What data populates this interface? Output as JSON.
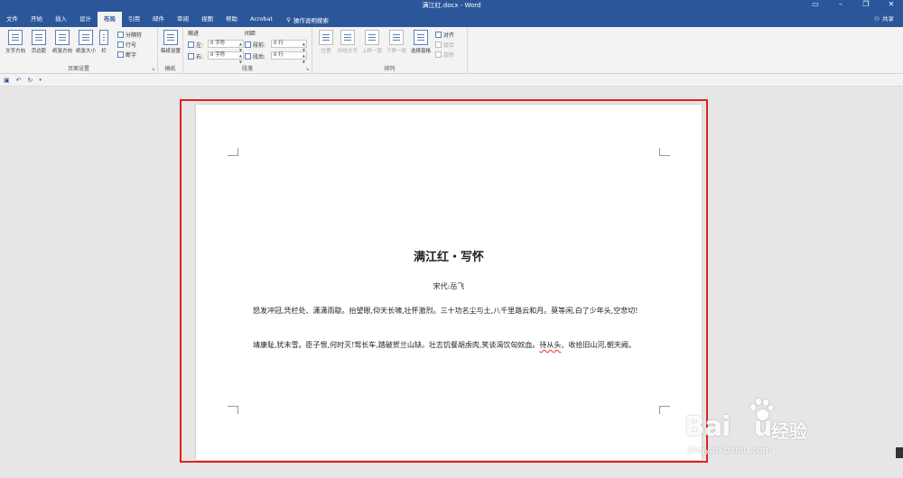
{
  "window": {
    "title": "满江红.docx - Word"
  },
  "tabs": [
    "文件",
    "开始",
    "插入",
    "设计",
    "布局",
    "引用",
    "邮件",
    "审阅",
    "视图",
    "帮助",
    "Acrobat"
  ],
  "active_tab": "布局",
  "tell_me": "操作说明搜索",
  "share": "共享",
  "ribbon": {
    "page_setup": {
      "text_direction": "文字方向",
      "margins": "页边距",
      "orientation": "纸张方向",
      "size": "纸张大小",
      "columns": "栏",
      "breaks": "分隔符",
      "line_numbers": "行号",
      "hyphenation": "断字",
      "label": "页面设置"
    },
    "draft": {
      "button": "稿纸设置",
      "label": "稿纸"
    },
    "paragraph": {
      "indent_header": "缩进",
      "spacing_header": "间距",
      "left_label": "左:",
      "left_value": "0 字符",
      "right_label": "右:",
      "right_value": "0 字符",
      "before_label": "段前:",
      "before_value": "0 行",
      "after_label": "段后:",
      "after_value": "0 行",
      "label": "段落"
    },
    "arrange": {
      "position": "位置",
      "wrap_text": "环绕文字",
      "bring_forward": "上移一层",
      "send_backward": "下移一层",
      "selection_pane": "选择窗格",
      "align": "对齐",
      "group": "组合",
      "rotate": "旋转",
      "label": "排列"
    }
  },
  "document": {
    "title": "满江红・写怀",
    "author": "宋代:岳飞",
    "p1": "怒发冲冠,凭栏处、潇潇雨歇。抬望眼,仰天长啸,壮怀激烈。三十功名尘与土,八千里路云和月。莫等闲,白了少年头,空悲切!",
    "p2_before": "靖康耻,犹未雪。臣子恨,何时灭!驾长车,踏破贺兰山缺。壮志饥餐胡虏肉,笑谈渴饮匈奴血。",
    "p2_mark": "待从头",
    "p2_after": "、收拾旧山河,朝天阙。"
  },
  "watermark": {
    "logo": "Bai",
    "logo_end": "u",
    "cn": "经验",
    "url": "jingyan.baidu.com"
  },
  "colors": {
    "ribbon": "#2b579a",
    "highlight": "#e02020"
  }
}
